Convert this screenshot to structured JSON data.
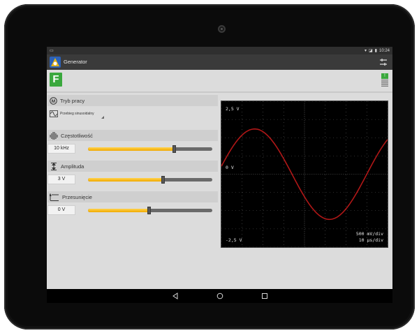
{
  "status": {
    "time": "10:24"
  },
  "appbar": {
    "title": "Generator"
  },
  "header": {
    "badge": "F"
  },
  "mode": {
    "label": "Tryb pracy",
    "selected": "Przebieg sinusoidalny"
  },
  "controls": [
    {
      "label": "Częstotliwość",
      "value": "10 kHz",
      "level": 0.69
    },
    {
      "label": "Amplituda",
      "value": "3 V",
      "level": 0.6
    },
    {
      "label": "Przesunięcie",
      "value": "0 V",
      "level": 0.49
    }
  ],
  "scope": {
    "top_label": "2,5 V",
    "mid_label": "0 V",
    "bottom_label": "-2,5 V",
    "scale_v": "500 mV/div",
    "scale_t": "10 µs/div",
    "trace_color": "#b01717"
  },
  "nav": {
    "back": "back-icon",
    "home": "home-icon",
    "recent": "recent-apps-icon"
  }
}
